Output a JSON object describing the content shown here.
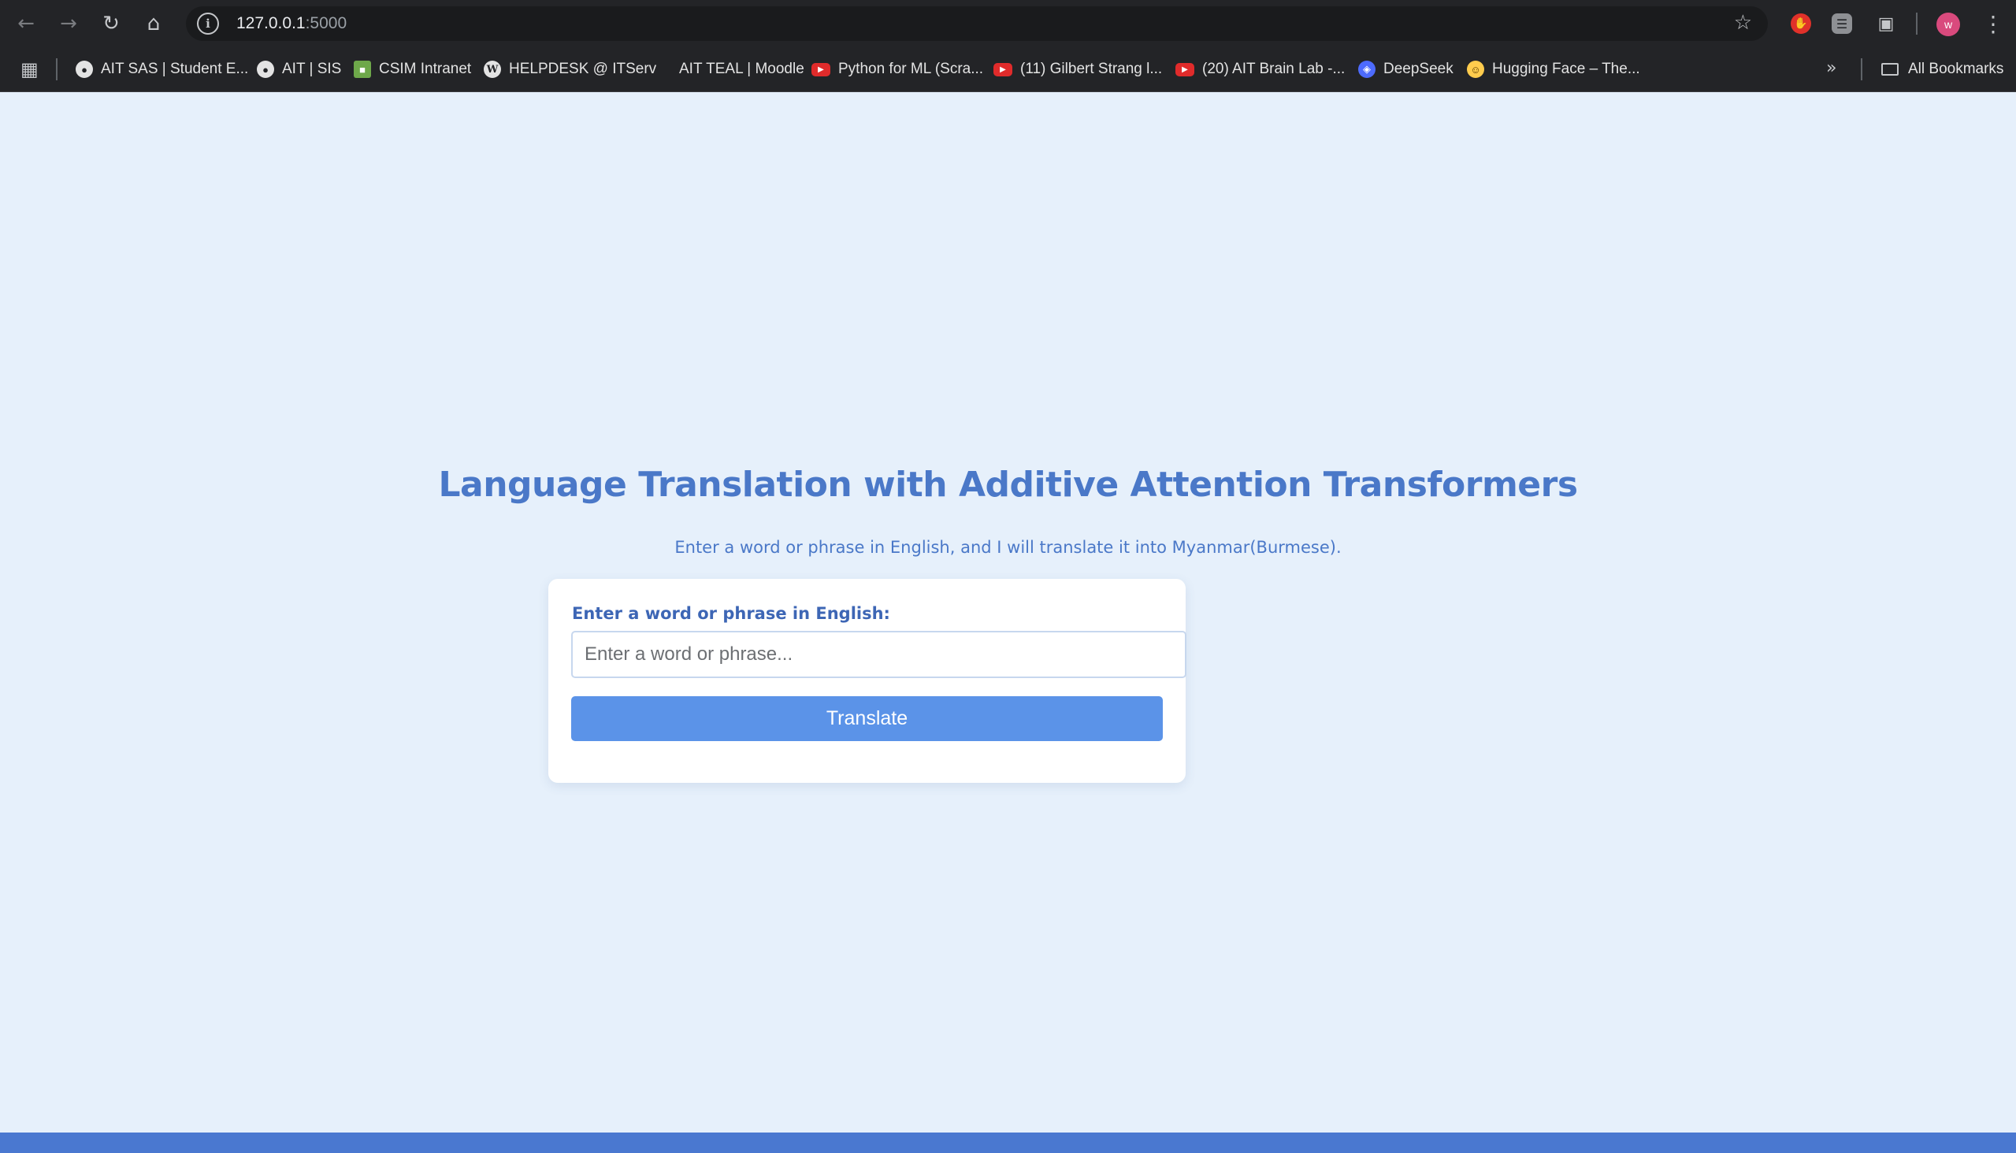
{
  "browser": {
    "url_host": "127.0.0.1",
    "url_port": ":5000",
    "profile_initial": "w",
    "bookmarks": [
      {
        "label": "AIT SAS | Student E...",
        "icon": "globe-icon"
      },
      {
        "label": "AIT | SIS",
        "icon": "globe-icon"
      },
      {
        "label": "CSIM Intranet",
        "icon": "csim-icon"
      },
      {
        "label": "HELPDESK @ ITServ",
        "icon": "wordpress-icon"
      },
      {
        "label": "AIT TEAL | Moodle",
        "icon": "none"
      },
      {
        "label": "Python for ML (Scra...",
        "icon": "youtube-icon"
      },
      {
        "label": "(11) Gilbert Strang l...",
        "icon": "youtube-icon"
      },
      {
        "label": "(20) AIT Brain Lab -...",
        "icon": "youtube-icon"
      },
      {
        "label": "DeepSeek",
        "icon": "deepseek-icon"
      },
      {
        "label": "Hugging Face – The...",
        "icon": "huggingface-icon"
      }
    ],
    "all_bookmarks_label": "All Bookmarks"
  },
  "page": {
    "title": "Language Translation with Additive Attention Transformers",
    "subtitle": "Enter a word or phrase in English, and I will translate it into Myanmar(Burmese).",
    "form": {
      "label": "Enter a word or phrase in English:",
      "input_value": "",
      "input_placeholder": "Enter a word or phrase...",
      "button_label": "Translate"
    }
  },
  "colors": {
    "page_background": "#e6f0fb",
    "accent": "#4a78c8",
    "button": "#5b93e8",
    "footer": "#4a78d0"
  }
}
